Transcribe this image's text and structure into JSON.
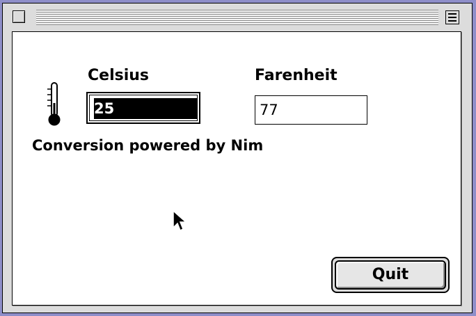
{
  "window": {
    "title": ""
  },
  "labels": {
    "celsius": "Celsius",
    "fahrenheit": "Farenheit",
    "footer": "Conversion powered by Nim"
  },
  "fields": {
    "celsius_value": "25",
    "fahrenheit_value": "77"
  },
  "buttons": {
    "quit": "Quit"
  },
  "icons": {
    "thermometer": "thermometer-icon",
    "cursor": "arrow-cursor"
  },
  "colors": {
    "desktop": "#8e8ec9",
    "window_chrome": "#dcdcdc",
    "selection": "#000000"
  }
}
